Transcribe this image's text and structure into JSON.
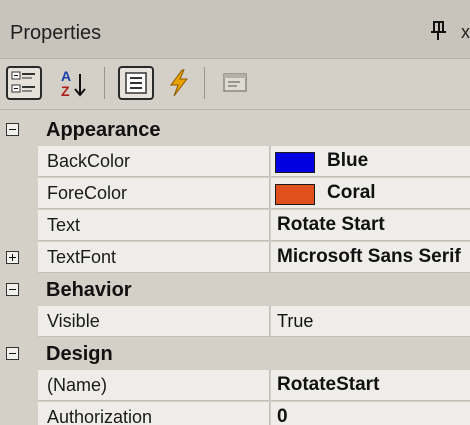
{
  "panel": {
    "title": "Properties",
    "close_partial": "x"
  },
  "toolbar": {
    "buttons": [
      {
        "name": "categorized",
        "icon": "categorized-icon",
        "active": true
      },
      {
        "name": "alphabetical",
        "icon": "sort-az-icon",
        "active": false
      },
      {
        "name": "properties",
        "icon": "properties-icon",
        "active": true
      },
      {
        "name": "events",
        "icon": "lightning-icon",
        "active": false
      },
      {
        "name": "property-pages",
        "icon": "property-pages-icon",
        "active": false
      }
    ]
  },
  "grid": {
    "categories": [
      {
        "label": "Appearance",
        "expanded": true,
        "properties": [
          {
            "name": "BackColor",
            "value": "Blue",
            "swatch": "#0000e0",
            "bold": true
          },
          {
            "name": "ForeColor",
            "value": "Coral",
            "swatch": "#e0501c",
            "bold": true
          },
          {
            "name": "Text",
            "value": "Rotate Start",
            "bold": true
          },
          {
            "name": "TextFont",
            "value": "Microsoft Sans Serif",
            "bold": true,
            "expandable": true
          }
        ]
      },
      {
        "label": "Behavior",
        "expanded": true,
        "properties": [
          {
            "name": "Visible",
            "value": "True",
            "bold": false
          }
        ]
      },
      {
        "label": "Design",
        "expanded": true,
        "properties": [
          {
            "name": "(Name)",
            "value": "RotateStart",
            "bold": true
          },
          {
            "name": "Authorization",
            "value": "0",
            "bold": true
          }
        ]
      }
    ]
  },
  "colors": {
    "panel_bg": "#d4d0c8",
    "cell_bg": "#efede9",
    "blue": "#0000e0",
    "coral": "#e0501c",
    "lightning": "#e8a000"
  }
}
